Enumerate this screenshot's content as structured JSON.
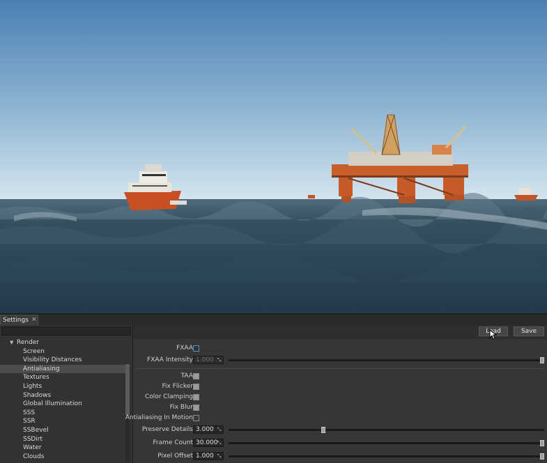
{
  "panel_tab": {
    "label": "Settings",
    "close": "×"
  },
  "tree": {
    "root": {
      "label": "Render",
      "expanded": true
    },
    "items": [
      {
        "label": "Screen"
      },
      {
        "label": "Visibility Distances"
      },
      {
        "label": "Antialiasing",
        "selected": true
      },
      {
        "label": "Textures"
      },
      {
        "label": "Lights"
      },
      {
        "label": "Shadows"
      },
      {
        "label": "Global Illumination"
      },
      {
        "label": "SSS"
      },
      {
        "label": "SSR"
      },
      {
        "label": "SSBevel"
      },
      {
        "label": "SSDirt"
      },
      {
        "label": "Water"
      },
      {
        "label": "Clouds"
      }
    ]
  },
  "toolbar": {
    "load_label": "Load",
    "save_label": "Save"
  },
  "settings": {
    "fxaa": {
      "label": "FXAA",
      "checked": false
    },
    "fxaa_intensity": {
      "label": "FXAA Intensity",
      "value": "1.000",
      "slider_fraction": 1.0,
      "disabled": true
    },
    "taa": {
      "label": "TAA",
      "checked": true
    },
    "fix_flicker": {
      "label": "Fix Flicker",
      "checked": true
    },
    "color_clamping": {
      "label": "Color Clamping",
      "checked": true
    },
    "fix_blur": {
      "label": "Fix Blur",
      "checked": true
    },
    "aa_in_motion": {
      "label": "Antialiasing In Motion",
      "checked": false
    },
    "preserve_details": {
      "label": "Preserve Details",
      "value": "3.000",
      "slider_fraction": 0.3
    },
    "frame_count": {
      "label": "Frame Count",
      "value": "30.000",
      "slider_fraction": 1.0
    },
    "pixel_offset": {
      "label": "Pixel Offset",
      "value": "1.000",
      "slider_fraction": 1.0
    }
  },
  "colors": {
    "sky_top": "#4a7fb3",
    "sky_horizon": "#cfe0ea",
    "sea": "#2c4656",
    "rig_orange": "#c0562a"
  }
}
